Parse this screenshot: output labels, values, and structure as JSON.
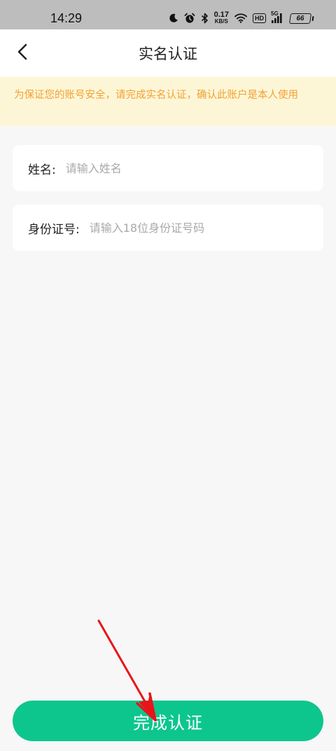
{
  "status_bar": {
    "time": "14:29",
    "net_speed_value": "0.17",
    "net_speed_unit": "KB/S",
    "hd_label": "HD",
    "network_type": "5G",
    "battery_level": "66",
    "icons": [
      "moon-icon",
      "alarm-icon",
      "bluetooth-icon",
      "wifi-icon",
      "signal-icon",
      "battery-icon"
    ]
  },
  "nav": {
    "title": "实名认证",
    "back_icon": "chevron-left-icon"
  },
  "notice": {
    "text": "为保证您的账号安全，请完成实名认证，确认此账户是本人使用"
  },
  "form": {
    "name_label": "姓名:",
    "name_placeholder": "请输入姓名",
    "name_value": "",
    "id_label": "身份证号:",
    "id_placeholder": "请输入18位身份证号码",
    "id_value": ""
  },
  "submit": {
    "label": "完成认证"
  },
  "colors": {
    "accent": "#0dc68e",
    "notice_bg": "#fdf6d6",
    "notice_text": "#f0a235",
    "annotation_arrow": "#e8141a"
  }
}
